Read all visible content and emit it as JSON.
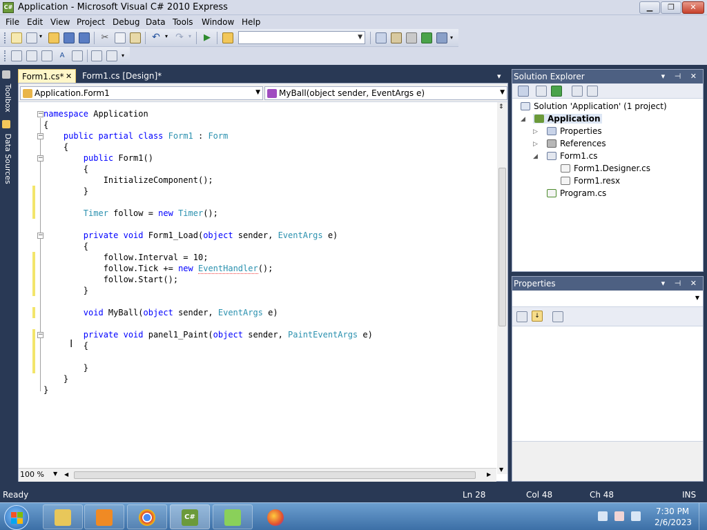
{
  "window": {
    "title": "Application - Microsoft Visual C# 2010 Express",
    "app_icon_glyph": "C#",
    "minimize": "▁",
    "maximize": "❐",
    "close": "✕"
  },
  "menu": [
    "File",
    "Edit",
    "View",
    "Project",
    "Debug",
    "Data",
    "Tools",
    "Window",
    "Help"
  ],
  "toolbar": {
    "config_value": ""
  },
  "side_tabs": {
    "toolbox": "Toolbox",
    "data_sources": "Data Sources"
  },
  "editor": {
    "tabs": [
      {
        "label": "Form1.cs*",
        "active": true,
        "close": "✕"
      },
      {
        "label": "Form1.cs [Design]*",
        "active": false
      }
    ],
    "tab_dropdown": "▾",
    "type_combo": "Application.Form1",
    "member_combo": "MyBall(object sender, EventArgs e)",
    "zoom": "100 %",
    "code_lines": [
      {
        "indent": "",
        "tokens": [
          {
            "t": "namespace ",
            "c": "kw"
          },
          {
            "t": "Application",
            "c": ""
          }
        ]
      },
      {
        "indent": "",
        "tokens": [
          {
            "t": "{",
            "c": ""
          }
        ]
      },
      {
        "indent": "    ",
        "tokens": [
          {
            "t": "public ",
            "c": "kw"
          },
          {
            "t": "partial ",
            "c": "kw"
          },
          {
            "t": "class ",
            "c": "kw"
          },
          {
            "t": "Form1",
            "c": "ty"
          },
          {
            "t": " : ",
            "c": ""
          },
          {
            "t": "Form",
            "c": "ty"
          }
        ]
      },
      {
        "indent": "    ",
        "tokens": [
          {
            "t": "{",
            "c": ""
          }
        ]
      },
      {
        "indent": "        ",
        "tokens": [
          {
            "t": "public ",
            "c": "kw"
          },
          {
            "t": "Form1()",
            "c": ""
          }
        ]
      },
      {
        "indent": "        ",
        "tokens": [
          {
            "t": "{",
            "c": ""
          }
        ]
      },
      {
        "indent": "            ",
        "tokens": [
          {
            "t": "InitializeComponent();",
            "c": ""
          }
        ]
      },
      {
        "indent": "        ",
        "tokens": [
          {
            "t": "}",
            "c": ""
          }
        ]
      },
      {
        "indent": "",
        "tokens": []
      },
      {
        "indent": "        ",
        "tokens": [
          {
            "t": "Timer",
            "c": "ty"
          },
          {
            "t": " follow = ",
            "c": ""
          },
          {
            "t": "new ",
            "c": "kw"
          },
          {
            "t": "Timer",
            "c": "ty"
          },
          {
            "t": "();",
            "c": ""
          }
        ]
      },
      {
        "indent": "",
        "tokens": []
      },
      {
        "indent": "        ",
        "tokens": [
          {
            "t": "private ",
            "c": "kw"
          },
          {
            "t": "void ",
            "c": "kw"
          },
          {
            "t": "Form1_Load(",
            "c": ""
          },
          {
            "t": "object ",
            "c": "kw"
          },
          {
            "t": "sender, ",
            "c": ""
          },
          {
            "t": "EventArgs",
            "c": "ty"
          },
          {
            "t": " e)",
            "c": ""
          }
        ]
      },
      {
        "indent": "        ",
        "tokens": [
          {
            "t": "{",
            "c": ""
          }
        ]
      },
      {
        "indent": "            ",
        "tokens": [
          {
            "t": "follow.Interval = 10;",
            "c": ""
          }
        ]
      },
      {
        "indent": "            ",
        "tokens": [
          {
            "t": "follow.Tick += ",
            "c": ""
          },
          {
            "t": "new",
            "c": "kw"
          },
          {
            "t": " ",
            "c": ""
          },
          {
            "t": "EventHandler",
            "c": "sq"
          },
          {
            "t": "();",
            "c": ""
          }
        ]
      },
      {
        "indent": "            ",
        "tokens": [
          {
            "t": "follow.Start();",
            "c": ""
          }
        ]
      },
      {
        "indent": "        ",
        "tokens": [
          {
            "t": "}",
            "c": ""
          }
        ]
      },
      {
        "indent": "",
        "tokens": []
      },
      {
        "indent": "        ",
        "tokens": [
          {
            "t": "void ",
            "c": "kw"
          },
          {
            "t": "MyBall(",
            "c": ""
          },
          {
            "t": "object ",
            "c": "kw"
          },
          {
            "t": "sender, ",
            "c": ""
          },
          {
            "t": "EventArgs",
            "c": "ty"
          },
          {
            "t": " e)",
            "c": ""
          }
        ]
      },
      {
        "indent": "",
        "tokens": []
      },
      {
        "indent": "        ",
        "tokens": [
          {
            "t": "private ",
            "c": "kw"
          },
          {
            "t": "void ",
            "c": "kw"
          },
          {
            "t": "panel1_Paint(",
            "c": ""
          },
          {
            "t": "object ",
            "c": "kw"
          },
          {
            "t": "sender, ",
            "c": ""
          },
          {
            "t": "PaintEventArgs",
            "c": "ty"
          },
          {
            "t": " e)",
            "c": ""
          }
        ]
      },
      {
        "indent": "        ",
        "tokens": [
          {
            "t": "{",
            "c": ""
          }
        ]
      },
      {
        "indent": "",
        "tokens": []
      },
      {
        "indent": "        ",
        "tokens": [
          {
            "t": "}",
            "c": ""
          }
        ]
      },
      {
        "indent": "    ",
        "tokens": [
          {
            "t": "}",
            "c": ""
          }
        ]
      },
      {
        "indent": "",
        "tokens": [
          {
            "t": "}",
            "c": ""
          }
        ]
      }
    ]
  },
  "solution_explorer": {
    "title": "Solution Explorer",
    "controls": "▾ ⊣ ✕",
    "items": [
      {
        "label": "Solution 'Application' (1 project)",
        "bold": false
      },
      {
        "label": "Application",
        "bold": true
      },
      {
        "label": "Properties",
        "bold": false
      },
      {
        "label": "References",
        "bold": false
      },
      {
        "label": "Form1.cs",
        "bold": false
      },
      {
        "label": "Form1.Designer.cs",
        "bold": false
      },
      {
        "label": "Form1.resx",
        "bold": false
      },
      {
        "label": "Program.cs",
        "bold": false
      }
    ]
  },
  "properties": {
    "title": "Properties",
    "controls": "▾ ⊣ ✕"
  },
  "status": {
    "ready": "Ready",
    "ln": "Ln 28",
    "col": "Col 48",
    "ch": "Ch 48",
    "mode": "INS"
  },
  "taskbar": {
    "time": "7:30 PM",
    "date": "2/6/2023"
  },
  "colors": {
    "chrome_dark": "#293955",
    "keyword": "#0000ff",
    "type": "#2b91af",
    "change_bar": "#f3e56b"
  }
}
